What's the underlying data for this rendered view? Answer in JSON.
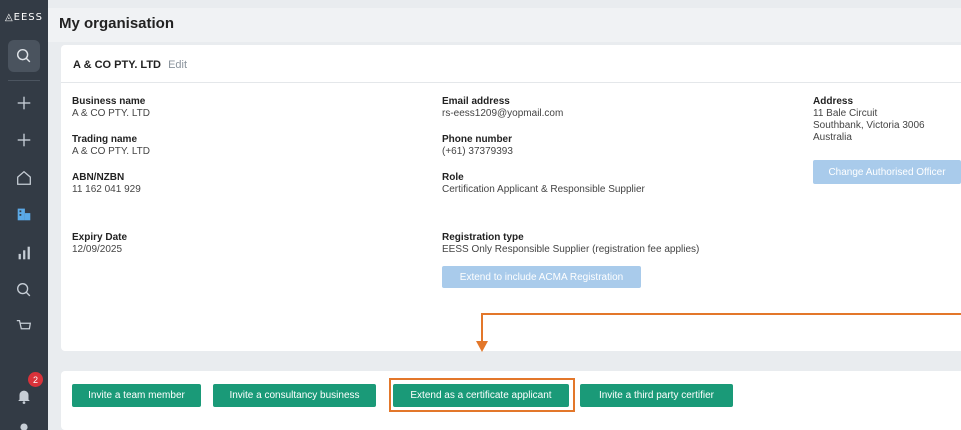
{
  "brand": {
    "name": "EESS"
  },
  "notifications": {
    "count": "2"
  },
  "page": {
    "title": "My organisation"
  },
  "org": {
    "name": "A & CO PTY. LTD",
    "edit_label": "Edit",
    "business_name": {
      "label": "Business name",
      "value": "A & CO PTY. LTD"
    },
    "trading_name": {
      "label": "Trading name",
      "value": "A & CO PTY. LTD"
    },
    "abn": {
      "label": "ABN/NZBN",
      "value": "11 162 041 929"
    },
    "expiry": {
      "label": "Expiry Date",
      "value": "12/09/2025"
    },
    "email": {
      "label": "Email address",
      "value": "rs-eess1209@yopmail.com"
    },
    "phone": {
      "label": "Phone number",
      "value": "(+61) 37379393"
    },
    "role": {
      "label": "Role",
      "value": "Certification Applicant & Responsible Supplier"
    },
    "registration": {
      "label": "Registration type",
      "value": "EESS Only Responsible Supplier (registration fee applies)"
    },
    "address": {
      "label": "Address",
      "line1": "11 Bale Circuit",
      "line2": "Southbank,  Victoria  3006",
      "line3": "Australia"
    }
  },
  "buttons": {
    "extend_acma": "Extend to include ACMA Registration",
    "change_officer": "Change Authorised Officer",
    "invite_team": "Invite a team member",
    "invite_consultancy": "Invite a consultancy business",
    "extend_applicant": "Extend as a certificate applicant",
    "invite_certifier": "Invite a third party certifier"
  },
  "colors": {
    "accent_green": "#1a9a78",
    "highlight_orange": "#e3772a",
    "sidebar": "#333b45",
    "disabled_blue": "#a9cbeb"
  }
}
